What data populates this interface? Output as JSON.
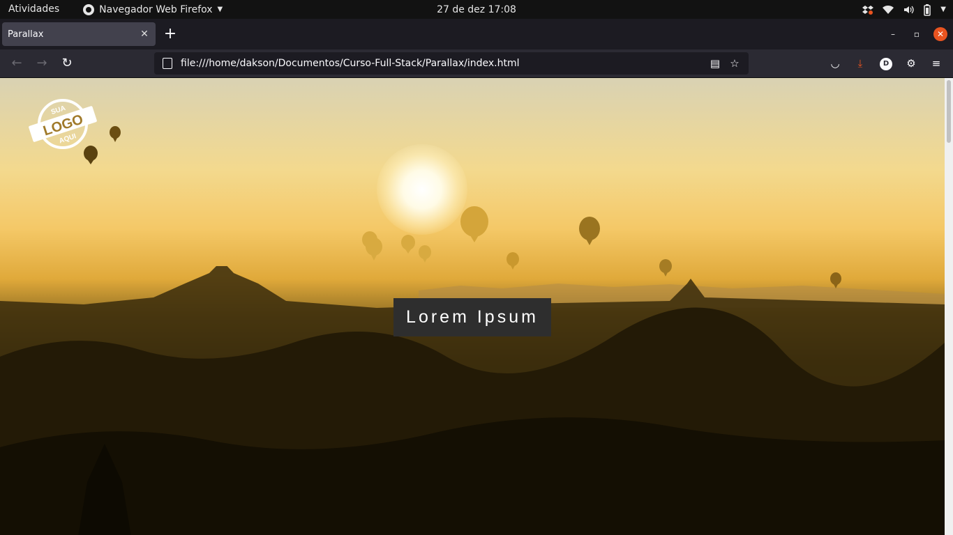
{
  "system_bar": {
    "activities": "Atividades",
    "app_name": "Navegador Web Firefox",
    "clock": "27 de dez  17:08"
  },
  "browser": {
    "tab_title": "Parallax",
    "url": "file:///home/dakson/Documentos/Curso-Full-Stack/Parallax/index.html",
    "account_initial": "D"
  },
  "page": {
    "logo_text": {
      "top": "SUA",
      "middle": "LOGO",
      "bottom": "AQUI"
    },
    "hero_text": "Lorem Ipsum"
  },
  "colors": {
    "accent_close": "#e95420",
    "download_icon": "#e95420",
    "hero_box": "#2e2e2e"
  }
}
